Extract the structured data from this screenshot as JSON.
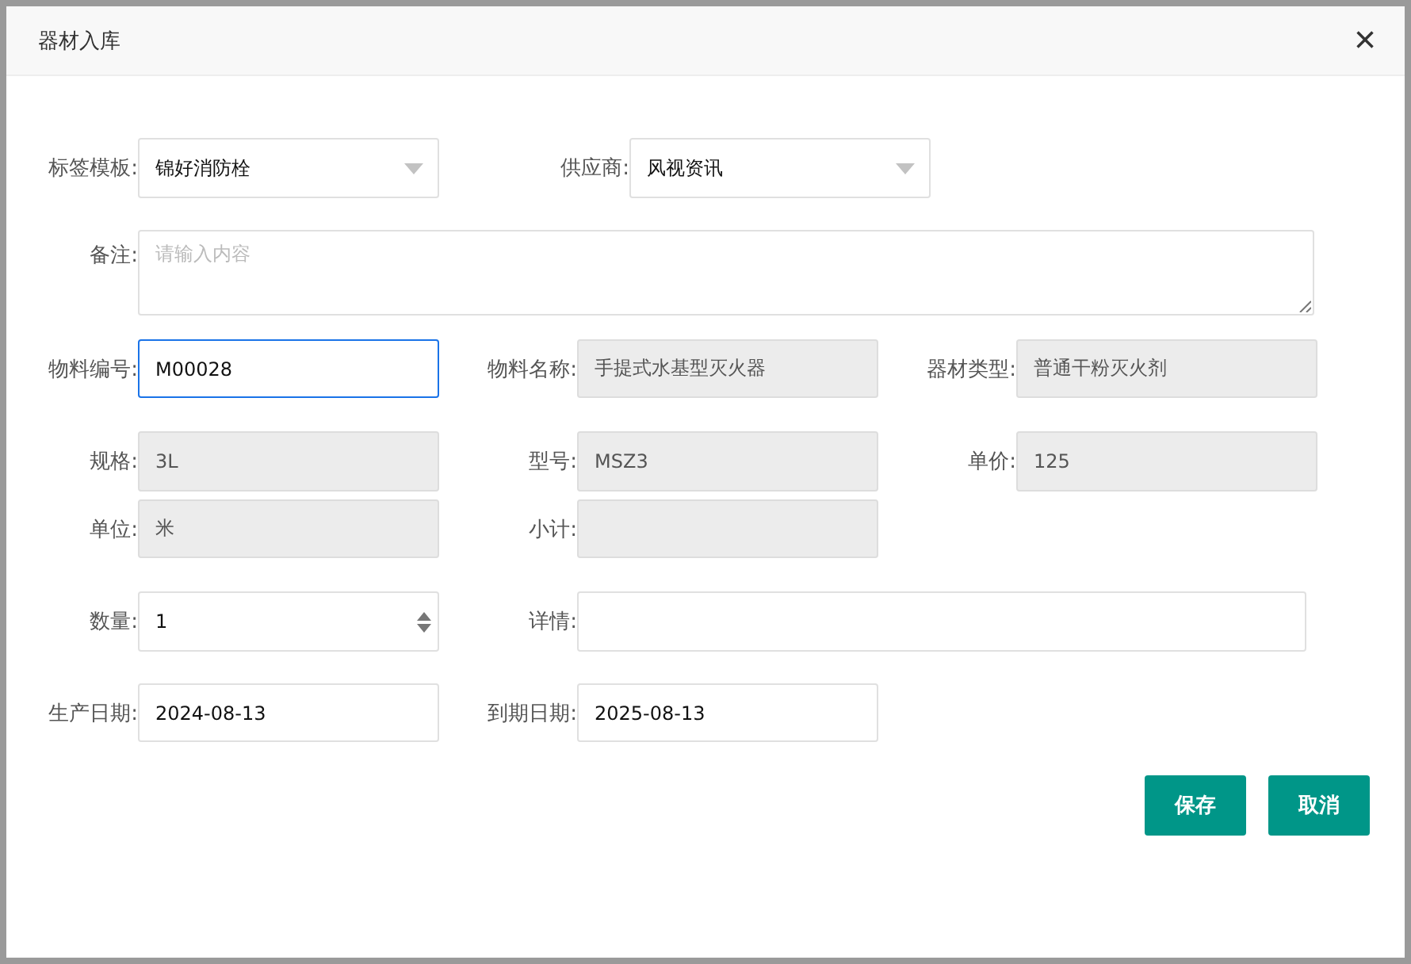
{
  "dialog": {
    "title": "器材入库",
    "close": "×"
  },
  "rows": [
    [
      {
        "label": "标签模板:",
        "kind": "select",
        "value": "锦好消防栓",
        "focused": false
      },
      {
        "label": "供应商:",
        "kind": "select",
        "value": "风视资讯",
        "focused": false
      }
    ],
    [
      {
        "label": "备注:",
        "kind": "textarea",
        "placeholder": "请输入内容",
        "focused": false
      }
    ],
    [
      {
        "label": "物料编号:",
        "kind": "text",
        "value": "M00028",
        "focused": true
      },
      {
        "label": "物料名称:",
        "kind": "readonly",
        "value": "手提式水基型灭火器",
        "focused": false
      },
      {
        "label": "器材类型:",
        "kind": "readonly",
        "value": "普通干粉灭火剂",
        "focused": false
      }
    ],
    [
      {
        "label": "规格:",
        "kind": "readonly",
        "value": "3L",
        "focused": false
      },
      {
        "label": "型号:",
        "kind": "readonly",
        "value": "MSZ3",
        "focused": false
      },
      {
        "label": "单价:",
        "kind": "readonly",
        "value": "125",
        "focused": false
      }
    ],
    [
      {
        "label": "单位:",
        "kind": "readonly",
        "value": "米",
        "focused": false
      },
      {
        "label": "小计:",
        "kind": "readonly",
        "focused": false
      }
    ],
    [
      {
        "label": "数量:",
        "kind": "number",
        "value": "1",
        "focused": false
      },
      {
        "label": "详情:",
        "kind": "wide",
        "focused": false
      }
    ],
    [
      {
        "label": "生产日期:",
        "kind": "text",
        "value": "2024-08-13",
        "focused": false
      },
      {
        "label": "到期日期:",
        "kind": "text",
        "value": "2025-08-13",
        "focused": false
      }
    ]
  ],
  "buttons": [
    "保存",
    "取消"
  ]
}
